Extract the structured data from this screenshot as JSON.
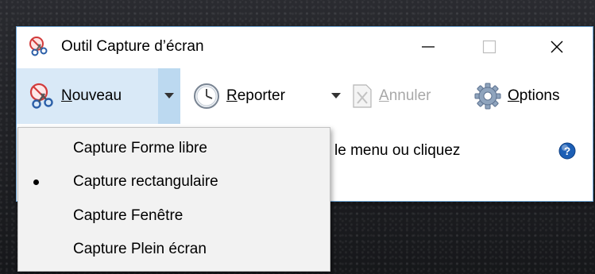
{
  "window": {
    "title": "Outil Capture d’écran",
    "controls": {
      "minimize": "—",
      "maximize": "□",
      "close": "✕"
    }
  },
  "toolbar": {
    "nouveau": {
      "mnemonic": "N",
      "rest": "ouveau"
    },
    "reporter": {
      "mnemonic": "R",
      "rest": "eporter"
    },
    "annuler": {
      "mnemonic": "A",
      "rest": "nnuler"
    },
    "options": {
      "mnemonic": "O",
      "rest": "ptions"
    }
  },
  "hint_text": "le menu ou cliquez",
  "menu": {
    "items": [
      {
        "label": "Capture Forme libre",
        "selected": false
      },
      {
        "label": "Capture rectangulaire",
        "selected": true
      },
      {
        "label": "Capture Fenêtre",
        "selected": false
      },
      {
        "label": "Capture Plein écran",
        "selected": false
      }
    ]
  },
  "colors": {
    "accent": "#d9e9f7",
    "accent_dark": "#bcd9f0",
    "window_border": "#6fa7d8",
    "help_icon": "#1d5fb5"
  },
  "icons": [
    "scissors-icon",
    "clock-icon",
    "cancel-icon",
    "gear-icon",
    "help-icon",
    "dropdown-arrow-icon"
  ]
}
